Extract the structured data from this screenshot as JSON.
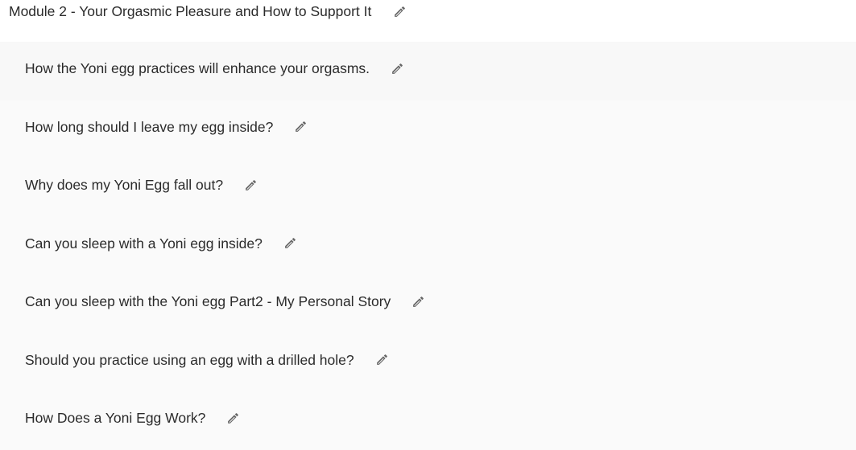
{
  "module": {
    "title": "Module 2 - Your Orgasmic Pleasure and How to Support It",
    "edit_icon": "pencil-icon"
  },
  "lessons": [
    {
      "title": "How the Yoni egg practices will enhance your orgasms.",
      "edit_icon": "pencil-icon"
    },
    {
      "title": "How long should I leave my egg inside?",
      "edit_icon": "pencil-icon"
    },
    {
      "title": "Why does my Yoni Egg fall out?",
      "edit_icon": "pencil-icon"
    },
    {
      "title": "Can you sleep with a Yoni egg inside?",
      "edit_icon": "pencil-icon"
    },
    {
      "title": "Can you sleep with the Yoni egg Part2 - My Personal Story",
      "edit_icon": "pencil-icon"
    },
    {
      "title": "Should you practice using an egg with a drilled hole?",
      "edit_icon": "pencil-icon"
    },
    {
      "title": "How Does a Yoni Egg Work?",
      "edit_icon": "pencil-icon"
    }
  ],
  "colors": {
    "text": "#2b2b2b",
    "icon": "#666666",
    "list_background": "#fafafa",
    "header_background": "#ffffff"
  }
}
